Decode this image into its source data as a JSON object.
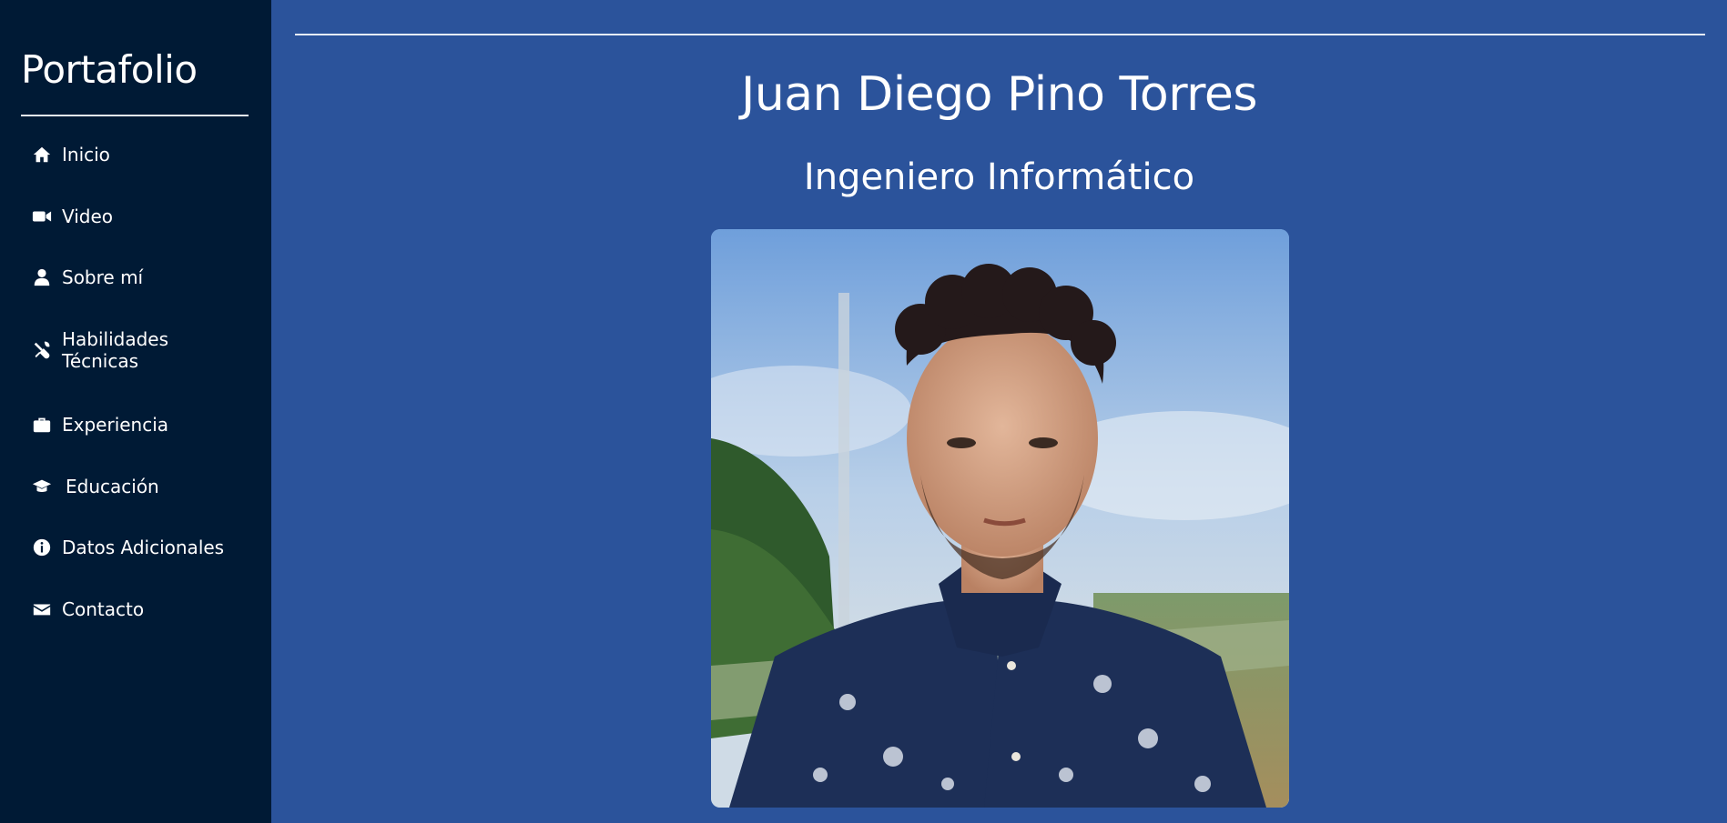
{
  "sidebar": {
    "brand": "Portafolio",
    "items": [
      {
        "label": "Inicio",
        "icon": "home-icon"
      },
      {
        "label": "Video",
        "icon": "video-camera-icon"
      },
      {
        "label": "Sobre mí",
        "icon": "user-icon"
      },
      {
        "label": "Habilidades Técnicas",
        "icon": "tools-icon"
      },
      {
        "label": "Experiencia",
        "icon": "briefcase-icon"
      },
      {
        "label": "Educación",
        "icon": "graduation-cap-icon"
      },
      {
        "label": "Datos Adicionales",
        "icon": "info-circle-icon"
      },
      {
        "label": "Contacto",
        "icon": "envelope-icon"
      }
    ]
  },
  "main": {
    "name": "Juan Diego Pino Torres",
    "role": "Ingeniero Informático"
  },
  "colors": {
    "sidebar_bg": "#001a35",
    "main_bg": "#2b539b",
    "text": "#ffffff"
  }
}
